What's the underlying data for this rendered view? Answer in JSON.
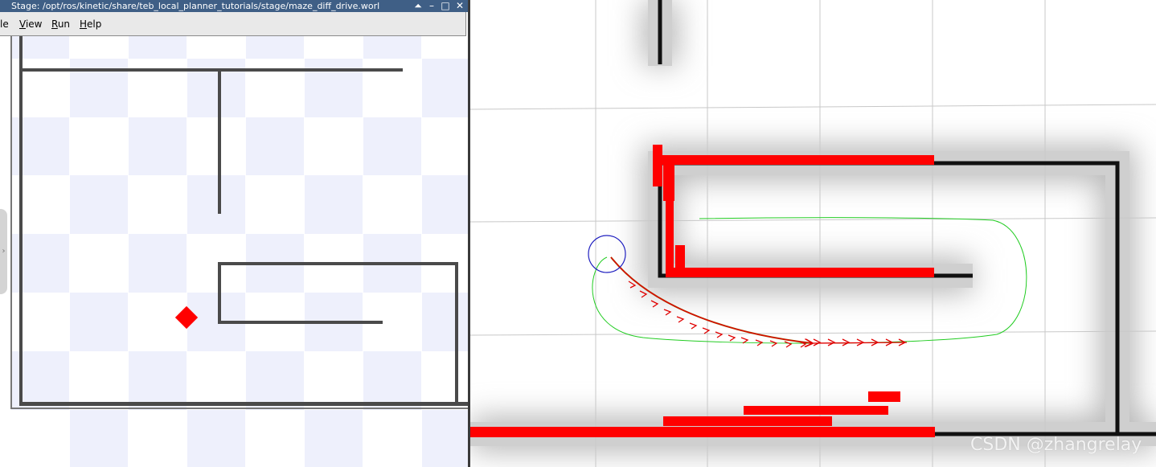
{
  "window": {
    "title": "Stage: /opt/ros/kinetic/share/teb_local_planner_tutorials/stage/maze_diff_drive.worl",
    "controls": {
      "shade": "⏶",
      "minimize": "–",
      "maximize": "□",
      "close": "✕"
    }
  },
  "menu": {
    "items": [
      {
        "label_prefix": "",
        "mnemonic": "",
        "label_rest": "le"
      },
      {
        "label_prefix": "",
        "mnemonic": "V",
        "label_rest": "iew"
      },
      {
        "label_prefix": "",
        "mnemonic": "R",
        "label_rest": "un"
      },
      {
        "label_prefix": "",
        "mnemonic": "H",
        "label_rest": "elp"
      }
    ]
  },
  "side_handle": {
    "glyph": "›"
  },
  "watermark": "CSDN @zhangrelay",
  "colors": {
    "titlebar": "#3f5f86",
    "grid_tint": "#eef0fc",
    "wall": "#4a4a4a",
    "robot": "#ff0000",
    "costmap_obstacle": "#ff0000",
    "global_plan": "#00cc00",
    "robot_footprint": "#2020c0"
  }
}
